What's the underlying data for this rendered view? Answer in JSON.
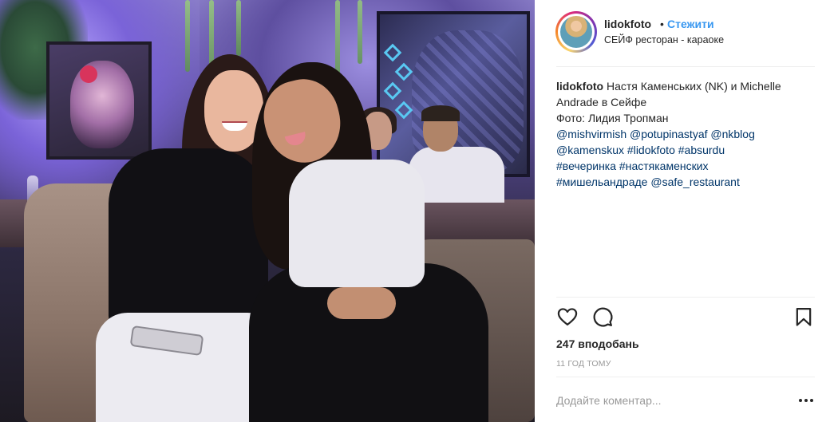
{
  "post": {
    "username": "lidokfoto",
    "separator": "•",
    "follow_label": "Стежити",
    "location": "СЕЙФ ресторан - караоке"
  },
  "caption": {
    "username": "lidokfoto",
    "line1_text": " Настя Каменських (NK) и Michelle",
    "line2_text": "Andrade в Сейфе",
    "line3_text": "Фото: Лидия Тропман",
    "tags_line4": [
      "@mishvirmish",
      "@potupinastyaf",
      "@nkblog"
    ],
    "tags_line5": [
      "@kamenskux",
      "#lidokfoto",
      "#absurdu"
    ],
    "tags_line6": [
      "#вечеринка",
      "#настякаменских"
    ],
    "tags_line7": [
      "#мишельандраде",
      "@safe_restaurant"
    ]
  },
  "actions": {
    "like_icon": "heart-icon",
    "comment_icon": "comment-icon",
    "save_icon": "bookmark-icon"
  },
  "likes_text": "247 вподобань",
  "time_text": "11 год тому",
  "comment": {
    "placeholder": "Додайте коментар...",
    "more_icon": "more-icon"
  },
  "colors": {
    "link": "#3897f0",
    "tag": "#003569",
    "muted": "#999999",
    "border": "#efefef"
  }
}
